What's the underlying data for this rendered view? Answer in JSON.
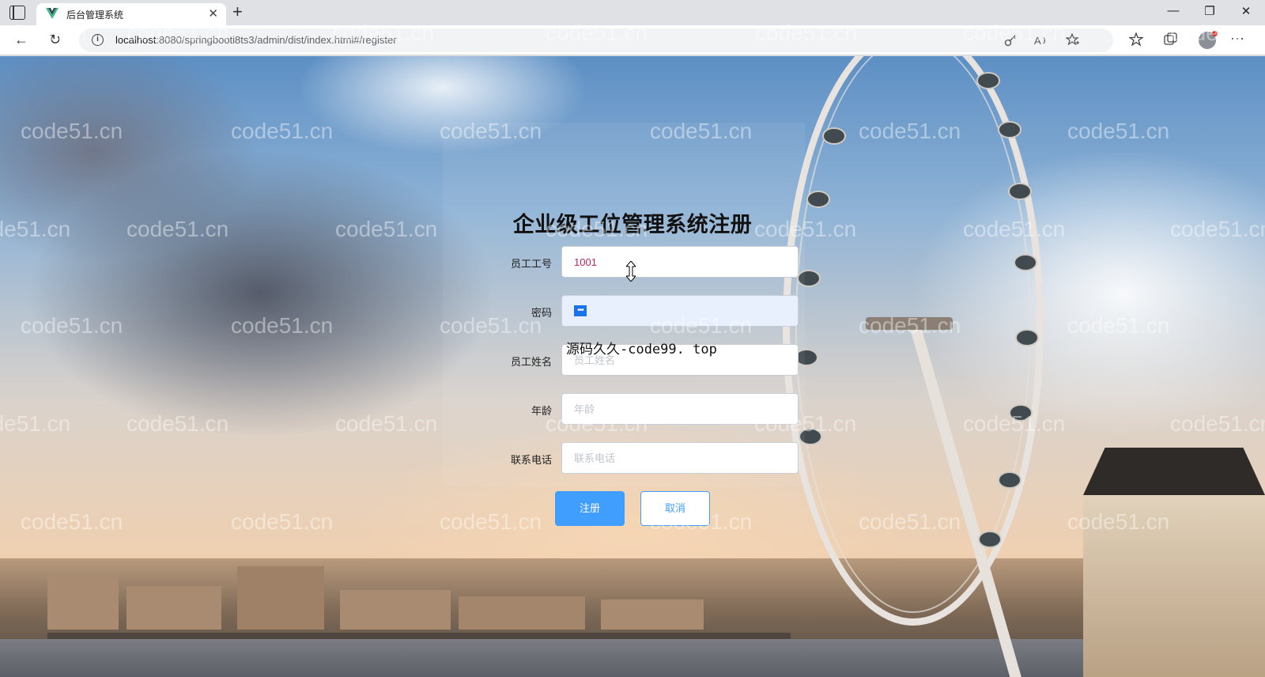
{
  "browser": {
    "tab_title": "后台管理系统",
    "url_host": "localhost",
    "url_rest": ":8080/springbooti8ts3/admin/dist/index.html#/register",
    "new_tab_glyph": "+",
    "tab_close_glyph": "✕"
  },
  "window_controls": {
    "minimize": "—",
    "restore": "❐",
    "close": "✕"
  },
  "nav": {
    "back": "←",
    "refresh": "↻",
    "more": "···"
  },
  "register_form": {
    "title": "企业级工位管理系统注册",
    "fields": [
      {
        "label": "员工工号",
        "value": "1001",
        "placeholder": ""
      },
      {
        "label": "密码",
        "value": "",
        "placeholder": ""
      },
      {
        "label": "员工姓名",
        "value": "",
        "placeholder": "员工姓名"
      },
      {
        "label": "年龄",
        "value": "",
        "placeholder": "年龄"
      },
      {
        "label": "联系电话",
        "value": "",
        "placeholder": "联系电话"
      }
    ],
    "password_mask": "•••",
    "submit_label": "注册",
    "cancel_label": "取消"
  },
  "overlay_note": "源码久久-code99. top",
  "watermark": "code51.cn",
  "colors": {
    "primary": "#409eff",
    "input_value": "#c0245e",
    "autofill_bg": "#e8f0fe"
  }
}
